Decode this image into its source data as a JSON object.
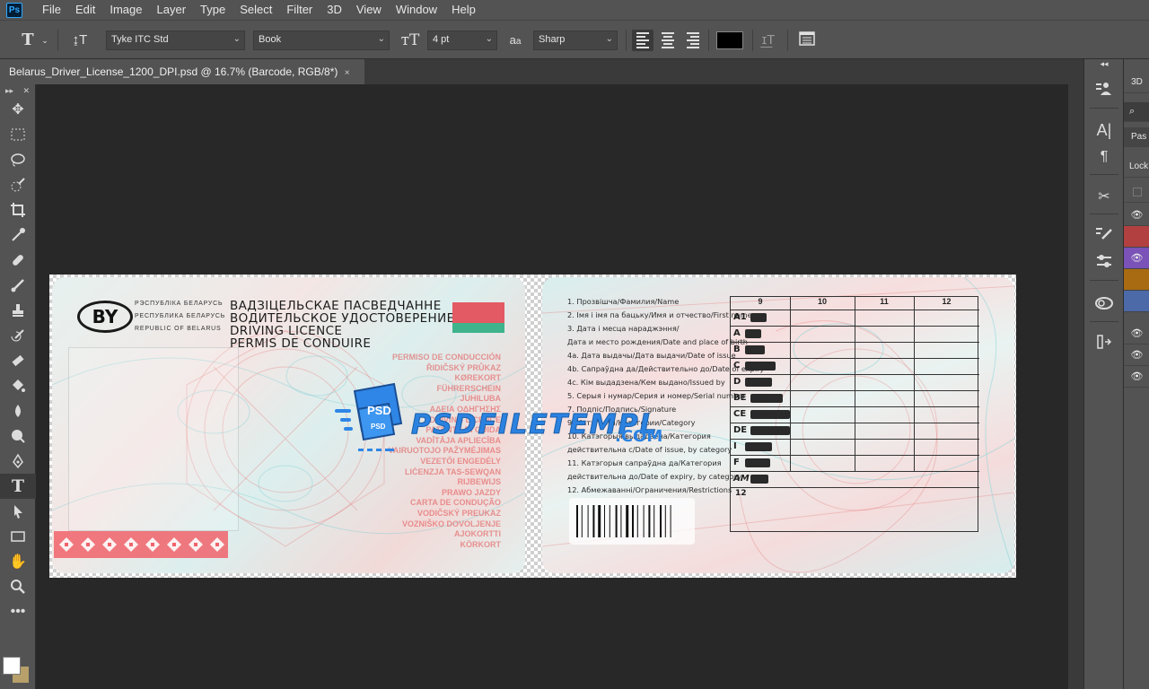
{
  "app": {
    "logo": "Ps"
  },
  "menu": [
    "File",
    "Edit",
    "Image",
    "Layer",
    "Type",
    "Select",
    "Filter",
    "3D",
    "View",
    "Window",
    "Help"
  ],
  "options": {
    "font_family": "Tyke ITC Std",
    "font_style": "Book",
    "font_size": "4 pt",
    "aa_label": "a",
    "antialias": "Sharp",
    "text_color": "#000000"
  },
  "document_tab": {
    "title": "Belarus_Driver_License_1200_DPI.psd @ 16.7% (Barcode, RGB/8*)",
    "close": "×"
  },
  "card_front": {
    "country_code": "BY",
    "republic_lines": [
      "РЭСПУБЛІКА БЕЛАРУСЬ",
      "РЕСПУБЛИКА БЕЛАРУСЬ",
      "REPUBLIC OF BELARUS"
    ],
    "title_lines": [
      "ВАДЗІЦЕЛЬСКАЕ ПАСВЕДЧАННЕ",
      "ВОДИТЕЛЬСКОЕ УДОСТОВЕРЕНИЕ",
      "DRIVING LICENCE",
      "PERMIS DE CONDUIRE"
    ],
    "red_words": [
      "PERMISO DE CONDUCCIÓN",
      "ŘIDIČSKÝ PRŮKAZ",
      "KØREKORT",
      "FÜHRERSCHEIN",
      "JUHILUBA",
      "ΑΔΕΙΑ ΟΔΗΓΗΣΗΣ",
      "DRIVING LICENCE",
      "PATENTE DI GUIDA",
      "VADĪTĀJA APLIECĪBA",
      "VAIRUOTOJO PAŽYMĖJIMAS",
      "VEZETŐI ENGEDÉLY",
      "LIĊENZJA TAS-SEWQAN",
      "RIJBEWIJS",
      "PRAWO JAZDY",
      "CARTA DE CONDUÇÃO",
      "VODIČSKÝ PREUKAZ",
      "VOZNIŠKO DOVOLJENJE",
      "AJOKORTTI",
      "KÖRKORT"
    ]
  },
  "watermark": {
    "text": "PSDFILETEMPL",
    "suffix": ".COM",
    "badge": "PSD"
  },
  "card_back": {
    "lines": [
      "1.   Прозвішча/Фамилия/Name",
      "2.   Імя і імя па бацьку/Имя и отчество/First name",
      "3.   Дата і месца нараджэння/",
      "      Дата и место рождения/Date and place of birth",
      "4a. Дата выдачы/Дата выдачи/Date of issue",
      "4b. Сапраўдна да/Действительно до/Date of expiry",
      "4c. Кім выдадзена/Кем выдано/Issued by",
      "5.   Серыя і нумар/Серия и номер/Serial number",
      "7.   Подпіс/Подпись/Signature",
      "9.   Катэгорыі/Категории/Category",
      "10. Катэгорыя выдадзена/Категория",
      "      действительна с/Date of issue, by category",
      "11. Катэгорыя сапраўдна да/Категория",
      "      действительна до/Date of expiry, by category",
      "12. Абмежаванні/Ограничения/Restrictions"
    ],
    "table_headers": [
      "9",
      "10",
      "11",
      "12"
    ],
    "categories": [
      "A1",
      "A",
      "B",
      "C",
      "D",
      "BE",
      "CE",
      "DE",
      "I",
      "F",
      "AM"
    ],
    "restrictions_label": "12"
  },
  "colors": {
    "accent": "#31a8ff",
    "flag_red": "#e45a64",
    "flag_green": "#3fb38c",
    "background_color": "#b7a069"
  }
}
